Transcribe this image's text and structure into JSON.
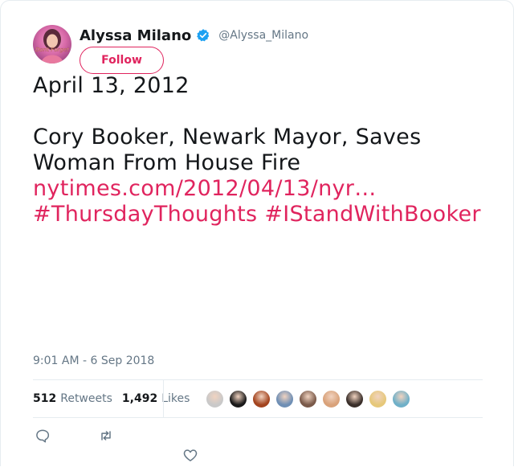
{
  "user": {
    "display_name": "Alyssa Milano",
    "handle": "@Alyssa_Milano",
    "verified": true,
    "avatar_icon": "profile-photo",
    "follow_label": "Follow"
  },
  "tweet": {
    "date_line": "April 13, 2012",
    "headline_1": "Cory Booker, Newark Mayor, Saves",
    "headline_2": "Woman From House Fire",
    "link": "nytimes.com/2012/04/13/nyr…",
    "hashtag_1": "#ThursdayThoughts",
    "hashtag_2": "#IStandWithBooker",
    "timestamp": "9:01 AM - 6 Sep 2018"
  },
  "stats": {
    "retweets_count": "512",
    "retweets_label": "Retweets",
    "likes_count": "1,492",
    "likes_label": "Likes"
  },
  "likers": [
    "#c9c9c9",
    "#1a1a1a",
    "#a3441f",
    "#6f8fb5",
    "#7a5a4a",
    "#d9a27a",
    "#3a2f2a",
    "#e6c87a",
    "#6fb0c8"
  ],
  "actions": [
    "reply-icon",
    "retweet-icon",
    "like-icon"
  ],
  "colors": {
    "accent": "#e0245e",
    "muted": "#657786",
    "verified": "#1da1f2"
  }
}
